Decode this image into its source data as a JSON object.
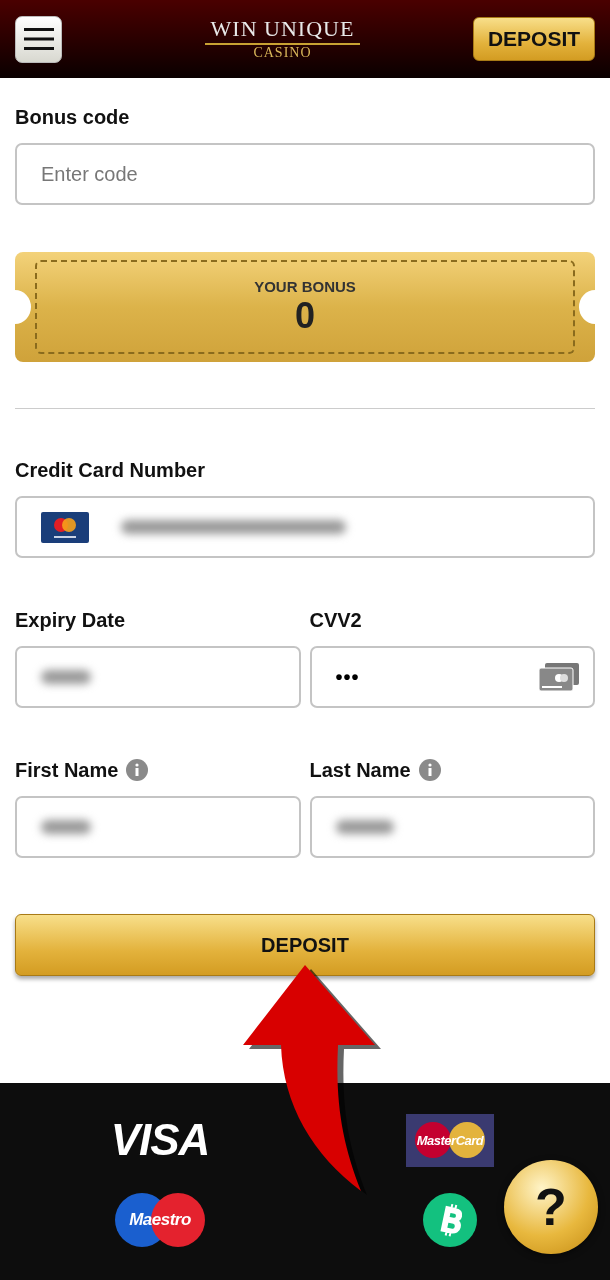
{
  "header": {
    "logo": {
      "title": "WIN UNIQUE",
      "subtitle": "CASINO"
    },
    "deposit_button": "DEPOSIT"
  },
  "bonus_code": {
    "label": "Bonus code",
    "placeholder": "Enter code"
  },
  "bonus_ticket": {
    "label": "YOUR BONUS",
    "value": "0"
  },
  "card_number": {
    "label": "Credit Card Number",
    "blurred": true
  },
  "field_rows": [
    {
      "fields": [
        {
          "label": "Expiry Date",
          "info": false,
          "blurred": true,
          "card_icon": false
        },
        {
          "label": "CVV2",
          "info": false,
          "blurred": false,
          "value": "•••",
          "card_icon": true
        }
      ]
    },
    {
      "fields": [
        {
          "label": "First Name",
          "info": true,
          "blurred": true,
          "card_icon": false
        },
        {
          "label": "Last Name",
          "info": true,
          "blurred": true,
          "card_icon": false
        }
      ]
    }
  ],
  "submit_button": "DEPOSIT",
  "payment_methods": [
    {
      "kind": "visa",
      "label": "VISA"
    },
    {
      "kind": "mastercard",
      "label": "MasterCard"
    },
    {
      "kind": "maestro",
      "label": "Maestro"
    },
    {
      "kind": "bitcoin"
    }
  ],
  "help_button": "?"
}
